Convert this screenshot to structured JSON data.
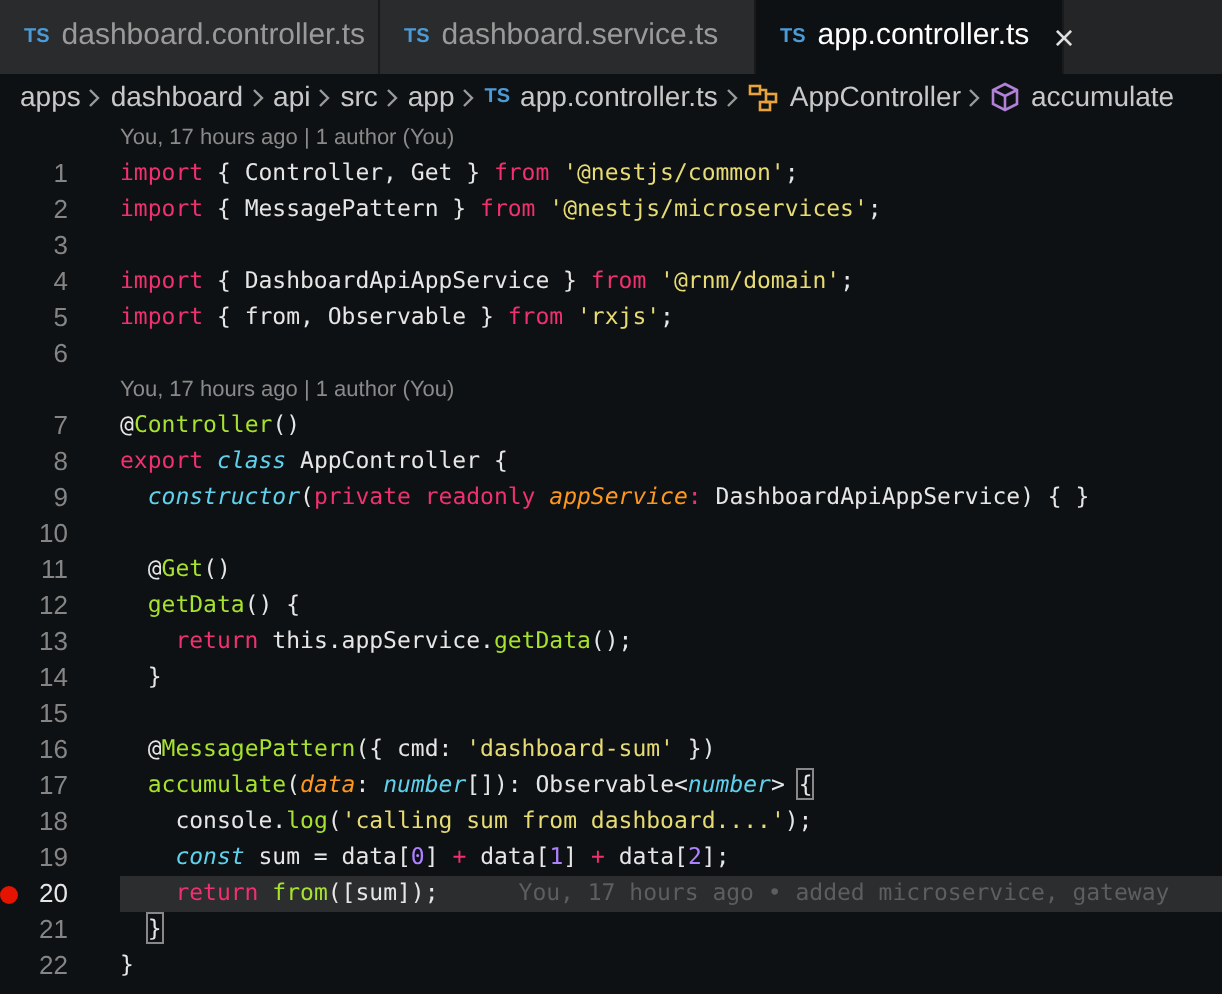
{
  "tabs": [
    {
      "icon": "TS",
      "label": "dashboard.controller.ts",
      "selected": false
    },
    {
      "icon": "TS",
      "label": "dashboard.service.ts",
      "selected": false
    },
    {
      "icon": "TS",
      "label": "app.controller.ts",
      "selected": true,
      "close": "×"
    }
  ],
  "breadcrumbs": [
    {
      "kind": "folder",
      "label": "apps"
    },
    {
      "kind": "folder",
      "label": "dashboard"
    },
    {
      "kind": "folder",
      "label": "api"
    },
    {
      "kind": "folder",
      "label": "src"
    },
    {
      "kind": "folder",
      "label": "app"
    },
    {
      "kind": "file",
      "icon": "TS",
      "label": "app.controller.ts"
    },
    {
      "kind": "class",
      "label": "AppController"
    },
    {
      "kind": "method",
      "label": "accumulate"
    }
  ],
  "lines": [
    {
      "kind": "lens",
      "text": "You, 17 hours ago | 1 author (You)"
    },
    {
      "kind": "code",
      "number": "1",
      "current": false,
      "breakpoint": false,
      "tokens": [
        {
          "kind": "keyword",
          "text": "import"
        },
        {
          "kind": "plain",
          "text": " { Controller, Get } "
        },
        {
          "kind": "keyword",
          "text": "from"
        },
        {
          "kind": "string",
          "text": " '@nestjs/common'"
        },
        {
          "kind": "plain",
          "text": ";"
        }
      ]
    },
    {
      "kind": "code",
      "number": "2",
      "current": false,
      "breakpoint": false,
      "tokens": [
        {
          "kind": "keyword",
          "text": "import"
        },
        {
          "kind": "plain",
          "text": " { MessagePattern } "
        },
        {
          "kind": "keyword",
          "text": "from"
        },
        {
          "kind": "string",
          "text": " '@nestjs/microservices'"
        },
        {
          "kind": "plain",
          "text": ";"
        }
      ]
    },
    {
      "kind": "code",
      "number": "3",
      "current": false,
      "breakpoint": false
    },
    {
      "kind": "code",
      "number": "4",
      "current": false,
      "breakpoint": false,
      "tokens": [
        {
          "kind": "keyword",
          "text": "import"
        },
        {
          "kind": "plain",
          "text": " { DashboardApiAppService } "
        },
        {
          "kind": "keyword",
          "text": "from"
        },
        {
          "kind": "string",
          "text": " '@rnm/domain'"
        },
        {
          "kind": "plain",
          "text": ";"
        }
      ]
    },
    {
      "kind": "code",
      "number": "5",
      "current": false,
      "breakpoint": false,
      "tokens": [
        {
          "kind": "keyword",
          "text": "import"
        },
        {
          "kind": "plain",
          "text": " { from, Observable } "
        },
        {
          "kind": "keyword",
          "text": "from"
        },
        {
          "kind": "string",
          "text": " 'rxjs'"
        },
        {
          "kind": "plain",
          "text": ";"
        }
      ]
    },
    {
      "kind": "code",
      "number": "6",
      "current": false,
      "breakpoint": false
    },
    {
      "kind": "lens",
      "text": "You, 17 hours ago | 1 author (You)"
    },
    {
      "kind": "code",
      "number": "7",
      "current": false,
      "breakpoint": false,
      "tokens": [
        {
          "kind": "plain",
          "text": "@"
        },
        {
          "kind": "function",
          "text": "Controller"
        },
        {
          "kind": "plain",
          "text": "()"
        }
      ]
    },
    {
      "kind": "code",
      "number": "8",
      "current": false,
      "breakpoint": false,
      "tokens": [
        {
          "kind": "keyword",
          "text": "export"
        },
        {
          "kind": "type",
          "text": " class"
        },
        {
          "kind": "plain",
          "text": " AppController {"
        }
      ]
    },
    {
      "kind": "code",
      "number": "9",
      "current": false,
      "breakpoint": false,
      "tokens": [
        {
          "kind": "type",
          "text": "  constructor"
        },
        {
          "kind": "plain",
          "text": "("
        },
        {
          "kind": "keyword",
          "text": "private readonly"
        },
        {
          "kind": "param",
          "text": " appService"
        },
        {
          "kind": "keyword",
          "text": ":"
        },
        {
          "kind": "plain",
          "text": " DashboardApiAppService) { }"
        }
      ]
    },
    {
      "kind": "code",
      "number": "10",
      "current": false,
      "breakpoint": false
    },
    {
      "kind": "code",
      "number": "11",
      "current": false,
      "breakpoint": false,
      "tokens": [
        {
          "kind": "plain",
          "text": "  @"
        },
        {
          "kind": "function",
          "text": "Get"
        },
        {
          "kind": "plain",
          "text": "()"
        }
      ]
    },
    {
      "kind": "code",
      "number": "12",
      "current": false,
      "breakpoint": false,
      "tokens": [
        {
          "kind": "function",
          "text": "  getData"
        },
        {
          "kind": "plain",
          "text": "() {"
        }
      ]
    },
    {
      "kind": "code",
      "number": "13",
      "current": false,
      "breakpoint": false,
      "tokens": [
        {
          "kind": "keyword",
          "text": "    return"
        },
        {
          "kind": "plain",
          "text": " this.appService."
        },
        {
          "kind": "function",
          "text": "getData"
        },
        {
          "kind": "plain",
          "text": "();"
        }
      ]
    },
    {
      "kind": "code",
      "number": "14",
      "current": false,
      "breakpoint": false,
      "tokens": [
        {
          "kind": "plain",
          "text": "  }"
        }
      ]
    },
    {
      "kind": "code",
      "number": "15",
      "current": false,
      "breakpoint": false
    },
    {
      "kind": "code",
      "number": "16",
      "current": false,
      "breakpoint": false,
      "tokens": [
        {
          "kind": "plain",
          "text": "  @"
        },
        {
          "kind": "function",
          "text": "MessagePattern"
        },
        {
          "kind": "plain",
          "text": "({ cmd: "
        },
        {
          "kind": "string",
          "text": "'dashboard-sum'"
        },
        {
          "kind": "plain",
          "text": " })"
        }
      ]
    },
    {
      "kind": "code",
      "number": "17",
      "current": false,
      "breakpoint": false,
      "tokens": [
        {
          "kind": "function",
          "text": "  accumulate"
        },
        {
          "kind": "plain",
          "text": "("
        },
        {
          "kind": "param",
          "text": "data"
        },
        {
          "kind": "plain",
          "text": ": "
        },
        {
          "kind": "type",
          "text": "number"
        },
        {
          "kind": "plain",
          "text": "[]): Observable<"
        },
        {
          "kind": "type",
          "text": "number"
        },
        {
          "kind": "plain",
          "text": "> "
        },
        {
          "kind": "bracket",
          "text": "{"
        }
      ]
    },
    {
      "kind": "code",
      "number": "18",
      "current": false,
      "breakpoint": false,
      "tokens": [
        {
          "kind": "plain",
          "text": "    console."
        },
        {
          "kind": "function",
          "text": "log"
        },
        {
          "kind": "plain",
          "text": "("
        },
        {
          "kind": "string",
          "text": "'calling sum from dashboard....'"
        },
        {
          "kind": "plain",
          "text": ");"
        }
      ]
    },
    {
      "kind": "code",
      "number": "19",
      "current": false,
      "breakpoint": false,
      "tokens": [
        {
          "kind": "type",
          "text": "    const"
        },
        {
          "kind": "plain",
          "text": " sum = data["
        },
        {
          "kind": "number",
          "text": "0"
        },
        {
          "kind": "plain",
          "text": "] "
        },
        {
          "kind": "keyword",
          "text": "+"
        },
        {
          "kind": "plain",
          "text": " data["
        },
        {
          "kind": "number",
          "text": "1"
        },
        {
          "kind": "plain",
          "text": "] "
        },
        {
          "kind": "keyword",
          "text": "+"
        },
        {
          "kind": "plain",
          "text": " data["
        },
        {
          "kind": "number",
          "text": "2"
        },
        {
          "kind": "plain",
          "text": "];"
        }
      ]
    },
    {
      "kind": "code",
      "number": "20",
      "current": true,
      "breakpoint": true,
      "blame": "You, 17 hours ago • added microservice, gateway",
      "tokens": [
        {
          "kind": "keyword",
          "text": "    return"
        },
        {
          "kind": "function",
          "text": " from"
        },
        {
          "kind": "plain",
          "text": "([sum]);"
        }
      ]
    },
    {
      "kind": "code",
      "number": "21",
      "current": false,
      "breakpoint": false,
      "tokens": [
        {
          "kind": "bracket",
          "text": "  }"
        }
      ]
    },
    {
      "kind": "code",
      "number": "22",
      "current": false,
      "breakpoint": false,
      "tokens": [
        {
          "kind": "plain",
          "text": "}"
        }
      ]
    }
  ]
}
